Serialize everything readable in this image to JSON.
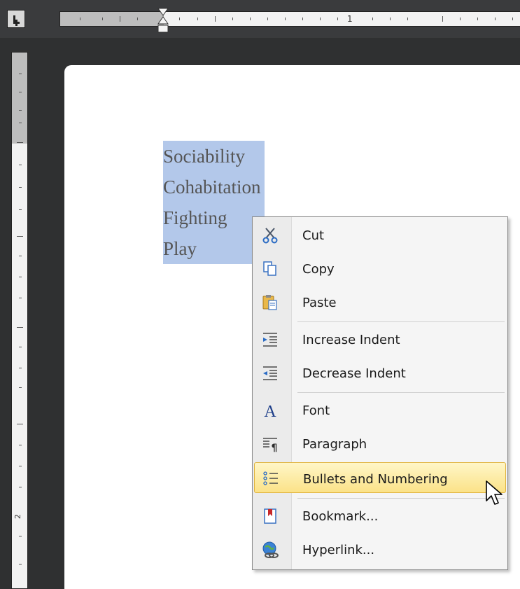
{
  "ruler": {
    "number_label": "1",
    "vertical_number_label": "2"
  },
  "document": {
    "selected_lines": [
      "Sociability",
      "Cohabitation",
      "Fighting",
      "Play"
    ]
  },
  "context_menu": {
    "items": [
      {
        "label": "Cut",
        "icon": "scissors-icon"
      },
      {
        "label": "Copy",
        "icon": "copy-icon"
      },
      {
        "label": "Paste",
        "icon": "paste-icon"
      },
      {
        "label": "Increase Indent",
        "icon": "increase-indent-icon"
      },
      {
        "label": "Decrease Indent",
        "icon": "decrease-indent-icon"
      },
      {
        "label": "Font",
        "icon": "font-icon"
      },
      {
        "label": "Paragraph",
        "icon": "paragraph-icon"
      },
      {
        "label": "Bullets and Numbering",
        "icon": "bullets-numbering-icon",
        "highlighted": true
      },
      {
        "label": "Bookmark...",
        "icon": "bookmark-icon"
      },
      {
        "label": "Hyperlink...",
        "icon": "hyperlink-icon"
      }
    ]
  },
  "colors": {
    "selection": "#b3c8ea",
    "menu_highlight": "#fbe288",
    "background": "#2f3031"
  }
}
